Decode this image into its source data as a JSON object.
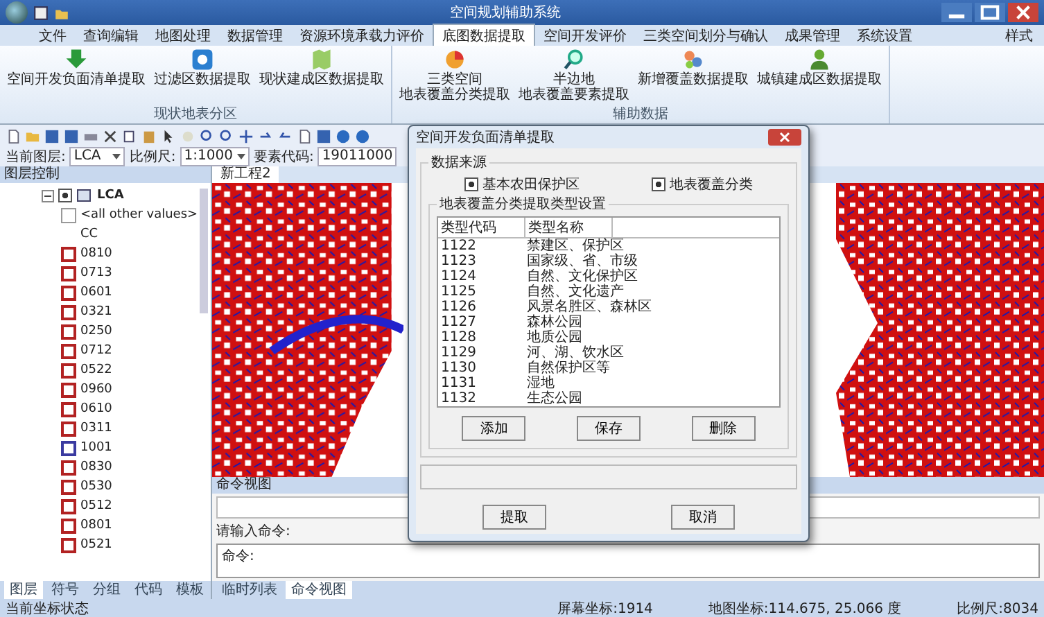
{
  "window": {
    "title": "空间规划辅助系统"
  },
  "menu_tabs": [
    {
      "label": "文件",
      "selected": false
    },
    {
      "label": "查询编辑",
      "selected": false
    },
    {
      "label": "地图处理",
      "selected": false
    },
    {
      "label": "数据管理",
      "selected": false
    },
    {
      "label": "资源环境承载力评价",
      "selected": false
    },
    {
      "label": "底图数据提取",
      "selected": true
    },
    {
      "label": "空间开发评价",
      "selected": false
    },
    {
      "label": "三类空间划分与确认",
      "selected": false
    },
    {
      "label": "成果管理",
      "selected": false
    },
    {
      "label": "系统设置",
      "selected": false
    }
  ],
  "style_menu": "样式",
  "ribbon_groups": [
    {
      "label": "现状地表分区",
      "buttons": [
        {
          "label": "空间开发负面清单提取",
          "kind": "arrow"
        },
        {
          "label": "过滤区数据提取",
          "kind": "disc"
        },
        {
          "label": "现状建成区数据提取",
          "kind": "map"
        }
      ]
    },
    {
      "label": "辅助数据",
      "buttons": [
        {
          "lines": [
            "三类空间",
            "地表覆盖分类提取"
          ],
          "kind": "pie"
        },
        {
          "lines": [
            "半边地",
            "地表覆盖要素提取"
          ],
          "kind": "magnifier"
        },
        {
          "label": "新增覆盖数据提取",
          "kind": "blocks"
        },
        {
          "label": "城镇建成区数据提取",
          "kind": "person"
        }
      ]
    }
  ],
  "layer_bar": {
    "layer_label": "当前图层:",
    "layer_value": "LCA",
    "scale_label": "比例尺:",
    "scale_value": "1:1000",
    "code_label": "要素代码:",
    "code_value": "19011000"
  },
  "layer_panel": {
    "title": "图层控制",
    "tree": [
      {
        "label": "LCA",
        "checked": true,
        "expanded": true,
        "children": [
          {
            "label": "<all other values>",
            "kind": "blank"
          },
          {
            "label": "CC",
            "kind": "text"
          },
          {
            "label": "0810",
            "kind": "swatch",
            "color": "#b22222"
          },
          {
            "label": "0713",
            "kind": "swatch",
            "color": "#b22222"
          },
          {
            "label": "0601",
            "kind": "swatch",
            "color": "#b22222"
          },
          {
            "label": "0321",
            "kind": "swatch",
            "color": "#b22222"
          },
          {
            "label": "0250",
            "kind": "swatch",
            "color": "#b22222"
          },
          {
            "label": "0712",
            "kind": "swatch",
            "color": "#b22222"
          },
          {
            "label": "0522",
            "kind": "swatch",
            "color": "#b22222"
          },
          {
            "label": "0960",
            "kind": "swatch",
            "color": "#b22222"
          },
          {
            "label": "0610",
            "kind": "swatch",
            "color": "#b22222"
          },
          {
            "label": "0311",
            "kind": "swatch",
            "color": "#b22222"
          },
          {
            "label": "1001",
            "kind": "swatch",
            "color": "#3a3aa0"
          },
          {
            "label": "0830",
            "kind": "swatch",
            "color": "#b22222"
          },
          {
            "label": "0530",
            "kind": "swatch",
            "color": "#b22222"
          },
          {
            "label": "0512",
            "kind": "swatch",
            "color": "#b22222"
          },
          {
            "label": "0801",
            "kind": "swatch",
            "color": "#b22222"
          },
          {
            "label": "0521",
            "kind": "swatch",
            "color": "#b22222"
          }
        ]
      }
    ],
    "tabs": [
      {
        "label": "图层",
        "selected": true
      },
      {
        "label": "符号",
        "selected": false
      },
      {
        "label": "分组",
        "selected": false
      },
      {
        "label": "代码",
        "selected": false
      },
      {
        "label": "模板",
        "selected": false
      }
    ]
  },
  "map_tab": {
    "label": "新工程2"
  },
  "command_panel": {
    "title": "命令视图",
    "prompt": "请输入命令:",
    "value": "命令:",
    "tabs": [
      {
        "label": "临时列表",
        "selected": false
      },
      {
        "label": "命令视图",
        "selected": true
      }
    ]
  },
  "dialog": {
    "title": "空间开发负面清单提取",
    "source_group": "数据来源",
    "sources": [
      {
        "label": "基本农田保护区",
        "checked": true
      },
      {
        "label": "地表覆盖分类",
        "checked": true
      }
    ],
    "list_group": "地表覆盖分类提取类型设置",
    "columns": [
      "类型代码",
      "类型名称"
    ],
    "rows": [
      {
        "code": "1122",
        "name": "禁建区、保护区"
      },
      {
        "code": "1123",
        "name": "国家级、省、市级"
      },
      {
        "code": "1124",
        "name": "自然、文化保护区"
      },
      {
        "code": "1125",
        "name": "自然、文化遗产"
      },
      {
        "code": "1126",
        "name": "风景名胜区、森林区"
      },
      {
        "code": "1127",
        "name": "森林公园"
      },
      {
        "code": "1128",
        "name": "地质公园"
      },
      {
        "code": "1129",
        "name": "河、湖、饮水区"
      },
      {
        "code": "1130",
        "name": "自然保护区等"
      },
      {
        "code": "1131",
        "name": "湿地"
      },
      {
        "code": "1132",
        "name": "生态公园"
      }
    ],
    "list_buttons": [
      "添加",
      "保存",
      "删除"
    ],
    "buttons": [
      "提取",
      "取消"
    ]
  },
  "status_bar": {
    "left": "当前坐标状态",
    "screen": "屏幕坐标:1914",
    "map": "地图坐标:114.675, 25.066 度",
    "scale": "比例尺:8034"
  }
}
